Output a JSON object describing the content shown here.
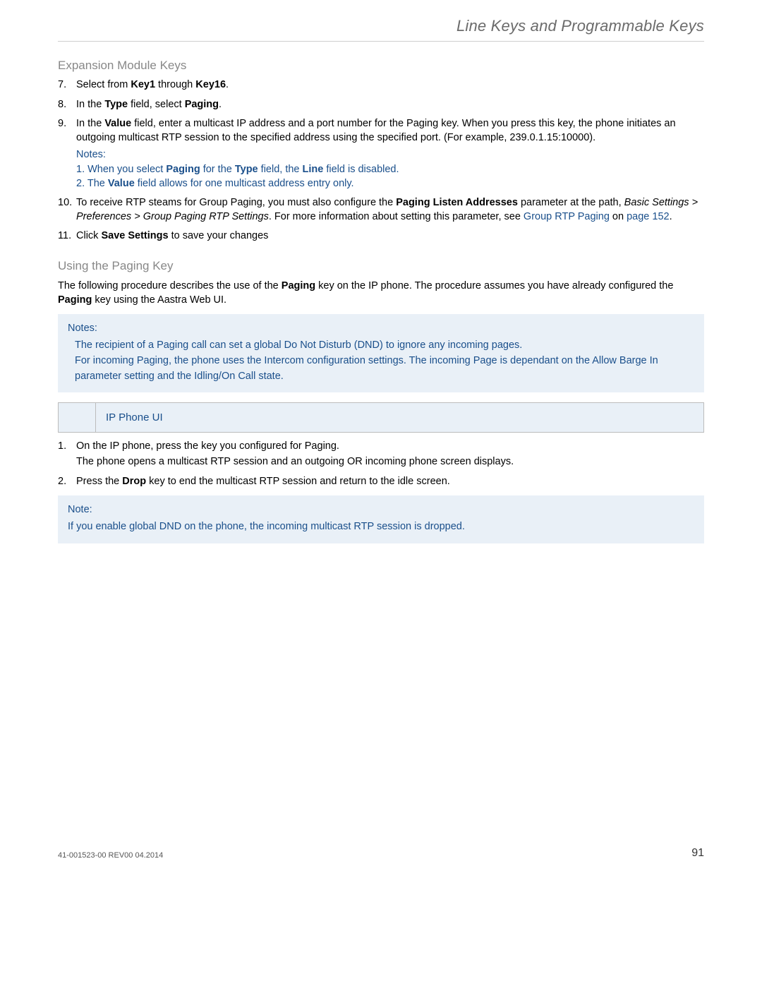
{
  "header": {
    "title": "Line Keys and Programmable Keys"
  },
  "expansion": {
    "heading": "Expansion Module Keys",
    "s7_a": "Select from ",
    "s7_b": "Key1",
    "s7_c": " through ",
    "s7_d": "Key16",
    "s7_e": ".",
    "s8_a": "In the ",
    "s8_b": "Type",
    "s8_c": " field, select ",
    "s8_d": "Paging",
    "s8_e": ".",
    "s9_a": "In the ",
    "s9_b": "Value",
    "s9_c": " field, enter a multicast IP address and a port number for the Paging key. When you press this key, the phone initiates an outgoing multicast RTP session to the specified address using the specified port. (For example, 239.0.1.15:10000).",
    "s9_notes_label": "Notes:",
    "s9_n1_a": "1. When you select ",
    "s9_n1_b": "Paging",
    "s9_n1_c": " for the ",
    "s9_n1_d": "Type",
    "s9_n1_e": " field, the ",
    "s9_n1_f": "Line",
    "s9_n1_g": " field is disabled.",
    "s9_n2_a": "2. The ",
    "s9_n2_b": "Value",
    "s9_n2_c": " field allows for one multicast address entry only.",
    "s10_a": "To receive RTP steams for Group Paging, you must also configure the ",
    "s10_b": "Paging Listen Addresses",
    "s10_c": " parameter at the path, ",
    "s10_path": "Basic Settings > Preferences > Group Paging RTP Settings",
    "s10_d": ". For more information about setting this parameter, see ",
    "s10_link": "Group RTP Paging",
    "s10_e": " on ",
    "s10_page": "page 152",
    "s10_f": ".",
    "s11_a": "Click ",
    "s11_b": "Save Settings",
    "s11_c": " to save your changes"
  },
  "using": {
    "heading": "Using the Paging Key",
    "intro_a": "The following procedure describes the use of the ",
    "intro_b": "Paging",
    "intro_c": " key on the IP phone. The procedure assumes you have already configured the ",
    "intro_d": "Paging",
    "intro_e": " key using the Aastra Web UI."
  },
  "notes_box": {
    "label": "Notes:",
    "line1": "The recipient of a Paging call can set a global Do Not Disturb (DND) to ignore any incoming pages.",
    "line2": " For incoming Paging, the phone uses the Intercom configuration settings. The incoming Page is dependant on the Allow Barge In parameter setting and the Idling/On Call state."
  },
  "ui_bar": {
    "label": "IP Phone UI"
  },
  "inner": {
    "i1_a": "On the IP phone, press the key you configured for Paging.",
    "i1_sub": "The phone opens a multicast RTP session and an outgoing OR incoming phone screen displays.",
    "i2_a": "Press the ",
    "i2_b": "Drop",
    "i2_c": " key to end the multicast RTP session and return to the idle screen."
  },
  "note_box2": {
    "label": "Note:",
    "line1": "If you enable global DND on the phone, the incoming multicast RTP session is dropped."
  },
  "footer": {
    "doc_id": "41-001523-00 REV00   04.2014",
    "page_num": "91"
  }
}
